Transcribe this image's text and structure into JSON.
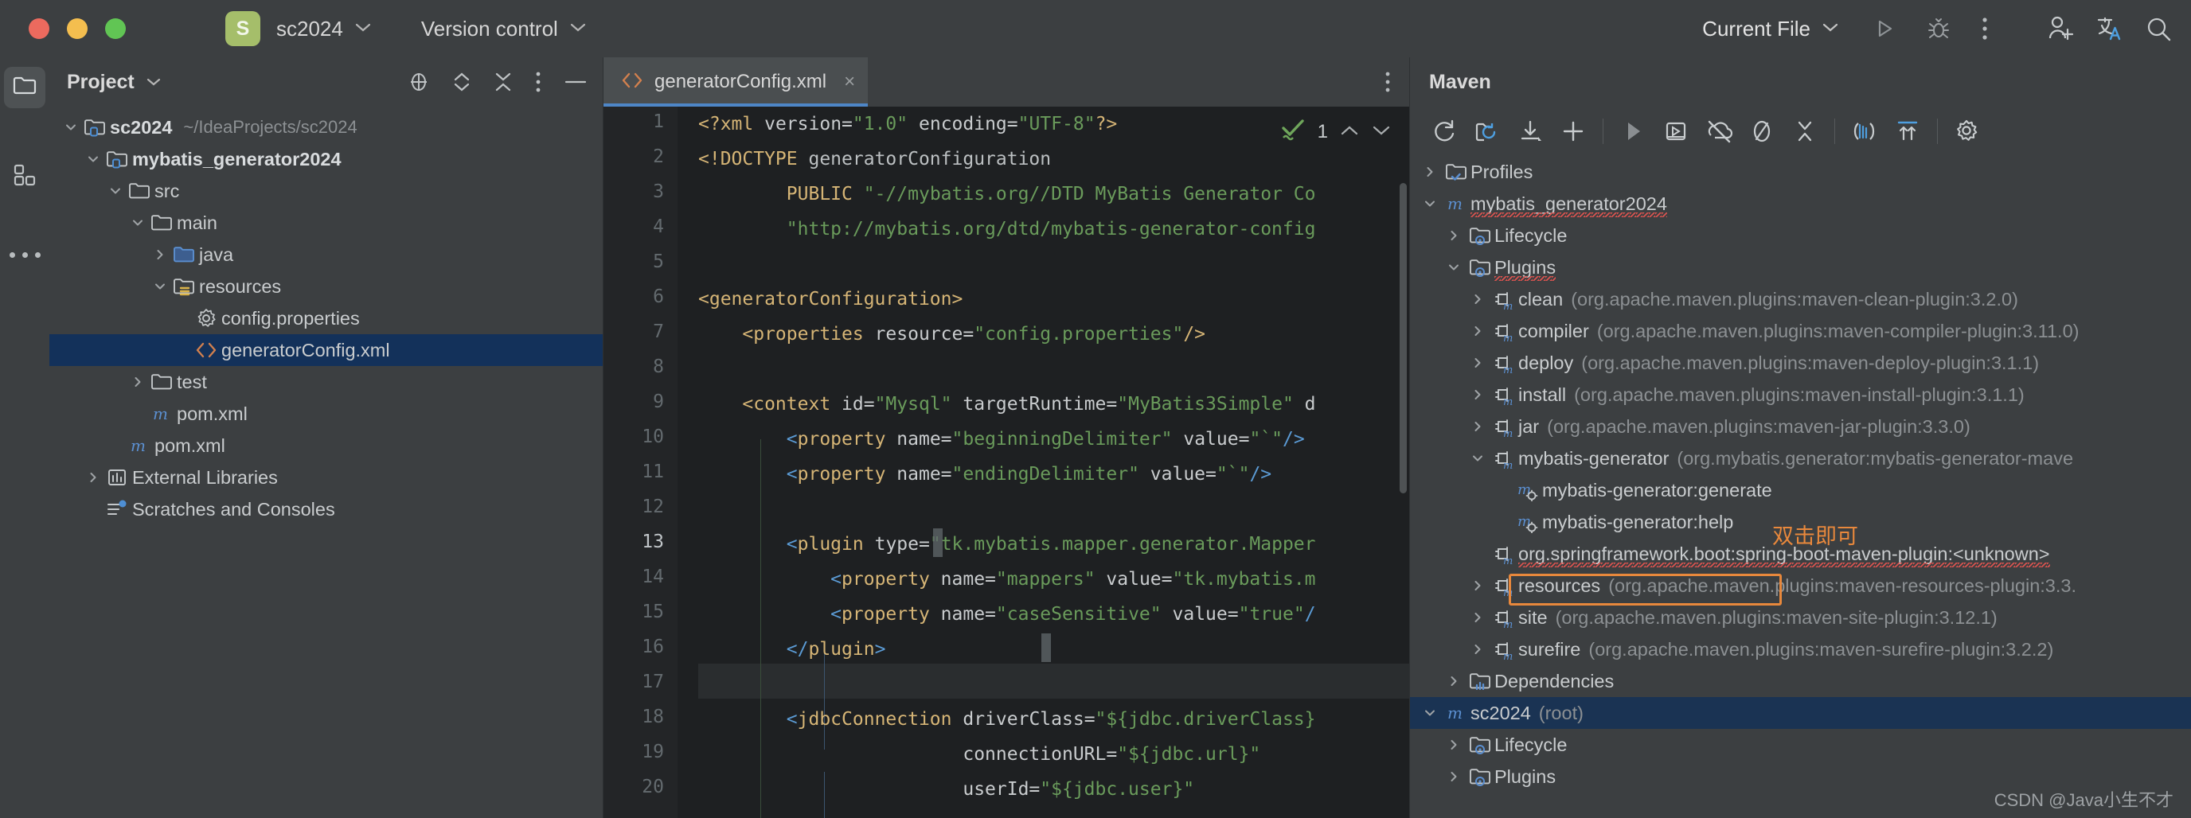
{
  "titlebar": {
    "window_controls": [
      "close",
      "minimize",
      "zoom"
    ],
    "project_badge": "S",
    "project_name": "sc2024",
    "version_control": "Version control",
    "run_config": "Current File",
    "icons": [
      "run-icon",
      "debug-icon",
      "more-vertical-icon",
      "add-user-icon",
      "translate-icon",
      "search-icon"
    ],
    "colors": {
      "close": "#EC6A5E",
      "minimize": "#F4BE4F",
      "zoom": "#61C554",
      "badge_bg": "#A5BE6A"
    }
  },
  "activitybar": {
    "items": [
      {
        "name": "project-tool-window",
        "icon": "folder-icon",
        "selected": true
      },
      {
        "name": "bookmarks-tool-window",
        "icon": "grid-icon",
        "selected": false
      },
      {
        "name": "more-tool-windows",
        "icon": "more-horizontal-icon",
        "selected": false
      }
    ]
  },
  "project_panel": {
    "title": "Project",
    "toolbar_icons": [
      "locate-icon",
      "expand-collapse-icon",
      "collapse-all-icon",
      "options-icon",
      "hide-icon"
    ],
    "tree": [
      {
        "label": "sc2024",
        "suffix": "~/IdeaProjects/sc2024",
        "depth": 0,
        "icon": "module-folder-icon",
        "arrow": "down",
        "bold": true,
        "selected": false
      },
      {
        "label": "mybatis_generator2024",
        "suffix": "",
        "depth": 1,
        "icon": "module-folder-icon",
        "arrow": "down",
        "bold": true,
        "selected": false
      },
      {
        "label": "src",
        "suffix": "",
        "depth": 2,
        "icon": "folder-icon",
        "arrow": "down",
        "bold": false,
        "selected": false
      },
      {
        "label": "main",
        "suffix": "",
        "depth": 3,
        "icon": "folder-icon",
        "arrow": "down",
        "bold": false,
        "selected": false
      },
      {
        "label": "java",
        "suffix": "",
        "depth": 4,
        "icon": "source-folder-icon",
        "arrow": "right",
        "bold": false,
        "selected": false
      },
      {
        "label": "resources",
        "suffix": "",
        "depth": 4,
        "icon": "resource-folder-icon",
        "arrow": "down",
        "bold": false,
        "selected": false
      },
      {
        "label": "config.properties",
        "suffix": "",
        "depth": 5,
        "icon": "properties-icon",
        "arrow": "none",
        "bold": false,
        "selected": false
      },
      {
        "label": "generatorConfig.xml",
        "suffix": "",
        "depth": 5,
        "icon": "xml-icon",
        "arrow": "none",
        "bold": false,
        "selected": true
      },
      {
        "label": "test",
        "suffix": "",
        "depth": 3,
        "icon": "folder-icon",
        "arrow": "right",
        "bold": false,
        "selected": false
      },
      {
        "label": "pom.xml",
        "suffix": "",
        "depth": 3,
        "icon": "maven-icon",
        "arrow": "none",
        "bold": false,
        "selected": false
      },
      {
        "label": "pom.xml",
        "suffix": "",
        "depth": 2,
        "icon": "maven-icon",
        "arrow": "none",
        "bold": false,
        "selected": false
      },
      {
        "label": "External Libraries",
        "suffix": "",
        "depth": 1,
        "icon": "library-icon",
        "arrow": "right",
        "bold": false,
        "selected": false
      },
      {
        "label": "Scratches and Consoles",
        "suffix": "",
        "depth": 1,
        "icon": "scratches-icon",
        "arrow": "none",
        "bold": false,
        "selected": false
      }
    ]
  },
  "editor": {
    "tab": {
      "label": "generatorConfig.xml",
      "icon": "xml-icon",
      "close": "×"
    },
    "tab_more_icon": "more-vertical-icon",
    "inspection": {
      "icon": "inspections-ok-icon",
      "count": "1",
      "prev": "⌃",
      "next": "⌄"
    },
    "lines": [
      {
        "n": "1",
        "current": false
      },
      {
        "n": "2",
        "current": false
      },
      {
        "n": "3",
        "current": false
      },
      {
        "n": "4",
        "current": false
      },
      {
        "n": "5",
        "current": false
      },
      {
        "n": "6",
        "current": false
      },
      {
        "n": "7",
        "current": false
      },
      {
        "n": "8",
        "current": false
      },
      {
        "n": "9",
        "current": false
      },
      {
        "n": "10",
        "current": false
      },
      {
        "n": "11",
        "current": false
      },
      {
        "n": "12",
        "current": false
      },
      {
        "n": "13",
        "current": true
      },
      {
        "n": "14",
        "current": false
      },
      {
        "n": "15",
        "current": false
      },
      {
        "n": "16",
        "current": false
      },
      {
        "n": "17",
        "current": false
      },
      {
        "n": "18",
        "current": false
      },
      {
        "n": "19",
        "current": false
      },
      {
        "n": "20",
        "current": false
      }
    ],
    "code_text": [
      "<?xml version=\"1.0\" encoding=\"UTF-8\"?>",
      "<!DOCTYPE generatorConfiguration",
      "        PUBLIC \"-//mybatis.org//DTD MyBatis Generator Co",
      "        \"http://mybatis.org/dtd/mybatis-generator-config",
      "",
      "<generatorConfiguration>",
      "    <properties resource=\"config.properties\"/>",
      "",
      "    <context id=\"Mysql\" targetRuntime=\"MyBatis3Simple\" d",
      "        <property name=\"beginningDelimiter\" value=\"`\"/>",
      "        <property name=\"endingDelimiter\" value=\"`\"/>",
      "",
      "        <plugin type=\"tk.mybatis.mapper.generator.Mapper",
      "            <property name=\"mappers\" value=\"tk.mybatis.m",
      "            <property name=\"caseSensitive\" value=\"true\"/",
      "        </plugin>",
      "",
      "        <jdbcConnection driverClass=\"${jdbc.driverClass}",
      "                        connectionURL=\"${jdbc.url}\"",
      "                        userId=\"${jdbc.user}\""
    ]
  },
  "maven_panel": {
    "title": "Maven",
    "toolbar_icons": [
      "reload-icon",
      "reload-project-icon",
      "download-sources-icon",
      "add-icon",
      "run-icon",
      "execute-goal-icon",
      "toggle-offline-icon",
      "toggle-skip-tests-icon",
      "collapse-all-icon",
      "show-dependencies-icon",
      "expand-icon",
      "settings-icon"
    ],
    "tree": [
      {
        "label": "Profiles",
        "coord": "",
        "depth": 0,
        "icon": "profiles-folder-icon",
        "arrow": "right",
        "selected": false,
        "squiggle": false
      },
      {
        "label": "mybatis_generator2024",
        "coord": "",
        "depth": 0,
        "icon": "maven-icon",
        "arrow": "down",
        "selected": false,
        "squiggle": true
      },
      {
        "label": "Lifecycle",
        "coord": "",
        "depth": 1,
        "icon": "phase-folder-icon",
        "arrow": "right",
        "selected": false,
        "squiggle": false
      },
      {
        "label": "Plugins",
        "coord": "",
        "depth": 1,
        "icon": "phase-folder-icon",
        "arrow": "down",
        "selected": false,
        "squiggle": true
      },
      {
        "label": "clean",
        "coord": "(org.apache.maven.plugins:maven-clean-plugin:3.2.0)",
        "depth": 2,
        "icon": "plugin-icon",
        "arrow": "right",
        "selected": false,
        "squiggle": false
      },
      {
        "label": "compiler",
        "coord": "(org.apache.maven.plugins:maven-compiler-plugin:3.11.0)",
        "depth": 2,
        "icon": "plugin-icon",
        "arrow": "right",
        "selected": false,
        "squiggle": false
      },
      {
        "label": "deploy",
        "coord": "(org.apache.maven.plugins:maven-deploy-plugin:3.1.1)",
        "depth": 2,
        "icon": "plugin-icon",
        "arrow": "right",
        "selected": false,
        "squiggle": false
      },
      {
        "label": "install",
        "coord": "(org.apache.maven.plugins:maven-install-plugin:3.1.1)",
        "depth": 2,
        "icon": "plugin-icon",
        "arrow": "right",
        "selected": false,
        "squiggle": false
      },
      {
        "label": "jar",
        "coord": "(org.apache.maven.plugins:maven-jar-plugin:3.3.0)",
        "depth": 2,
        "icon": "plugin-icon",
        "arrow": "right",
        "selected": false,
        "squiggle": false
      },
      {
        "label": "mybatis-generator",
        "coord": "(org.mybatis.generator:mybatis-generator-mave",
        "depth": 2,
        "icon": "plugin-icon",
        "arrow": "down",
        "selected": false,
        "squiggle": false
      },
      {
        "label": "mybatis-generator:generate",
        "coord": "",
        "depth": 3,
        "icon": "goal-icon",
        "arrow": "none",
        "selected": false,
        "squiggle": false
      },
      {
        "label": "mybatis-generator:help",
        "coord": "",
        "depth": 3,
        "icon": "goal-icon",
        "arrow": "none",
        "selected": false,
        "squiggle": false
      },
      {
        "label": "org.springframework.boot:spring-boot-maven-plugin:<unknown>",
        "coord": "",
        "depth": 2,
        "icon": "plugin-icon",
        "arrow": "none",
        "selected": false,
        "squiggle": true
      },
      {
        "label": "resources",
        "coord": "(org.apache.maven.plugins:maven-resources-plugin:3.3.",
        "depth": 2,
        "icon": "plugin-icon",
        "arrow": "right",
        "selected": false,
        "squiggle": false
      },
      {
        "label": "site",
        "coord": "(org.apache.maven.plugins:maven-site-plugin:3.12.1)",
        "depth": 2,
        "icon": "plugin-icon",
        "arrow": "right",
        "selected": false,
        "squiggle": false
      },
      {
        "label": "surefire",
        "coord": "(org.apache.maven.plugins:maven-surefire-plugin:3.2.2)",
        "depth": 2,
        "icon": "plugin-icon",
        "arrow": "right",
        "selected": false,
        "squiggle": false
      },
      {
        "label": "Dependencies",
        "coord": "",
        "depth": 1,
        "icon": "dependencies-folder-icon",
        "arrow": "right",
        "selected": false,
        "squiggle": false
      },
      {
        "label": "sc2024",
        "coord": "(root)",
        "depth": 0,
        "icon": "maven-icon",
        "arrow": "down",
        "selected": true,
        "squiggle": false
      },
      {
        "label": "Lifecycle",
        "coord": "",
        "depth": 1,
        "icon": "phase-folder-icon",
        "arrow": "right",
        "selected": false,
        "squiggle": false
      },
      {
        "label": "Plugins",
        "coord": "",
        "depth": 1,
        "icon": "phase-folder-icon",
        "arrow": "right",
        "selected": false,
        "squiggle": false
      }
    ],
    "annotation": {
      "text": "双击即可",
      "color": "#E8883C",
      "target": "mybatis-generator:generate"
    },
    "watermark": "CSDN @Java小生不才"
  }
}
